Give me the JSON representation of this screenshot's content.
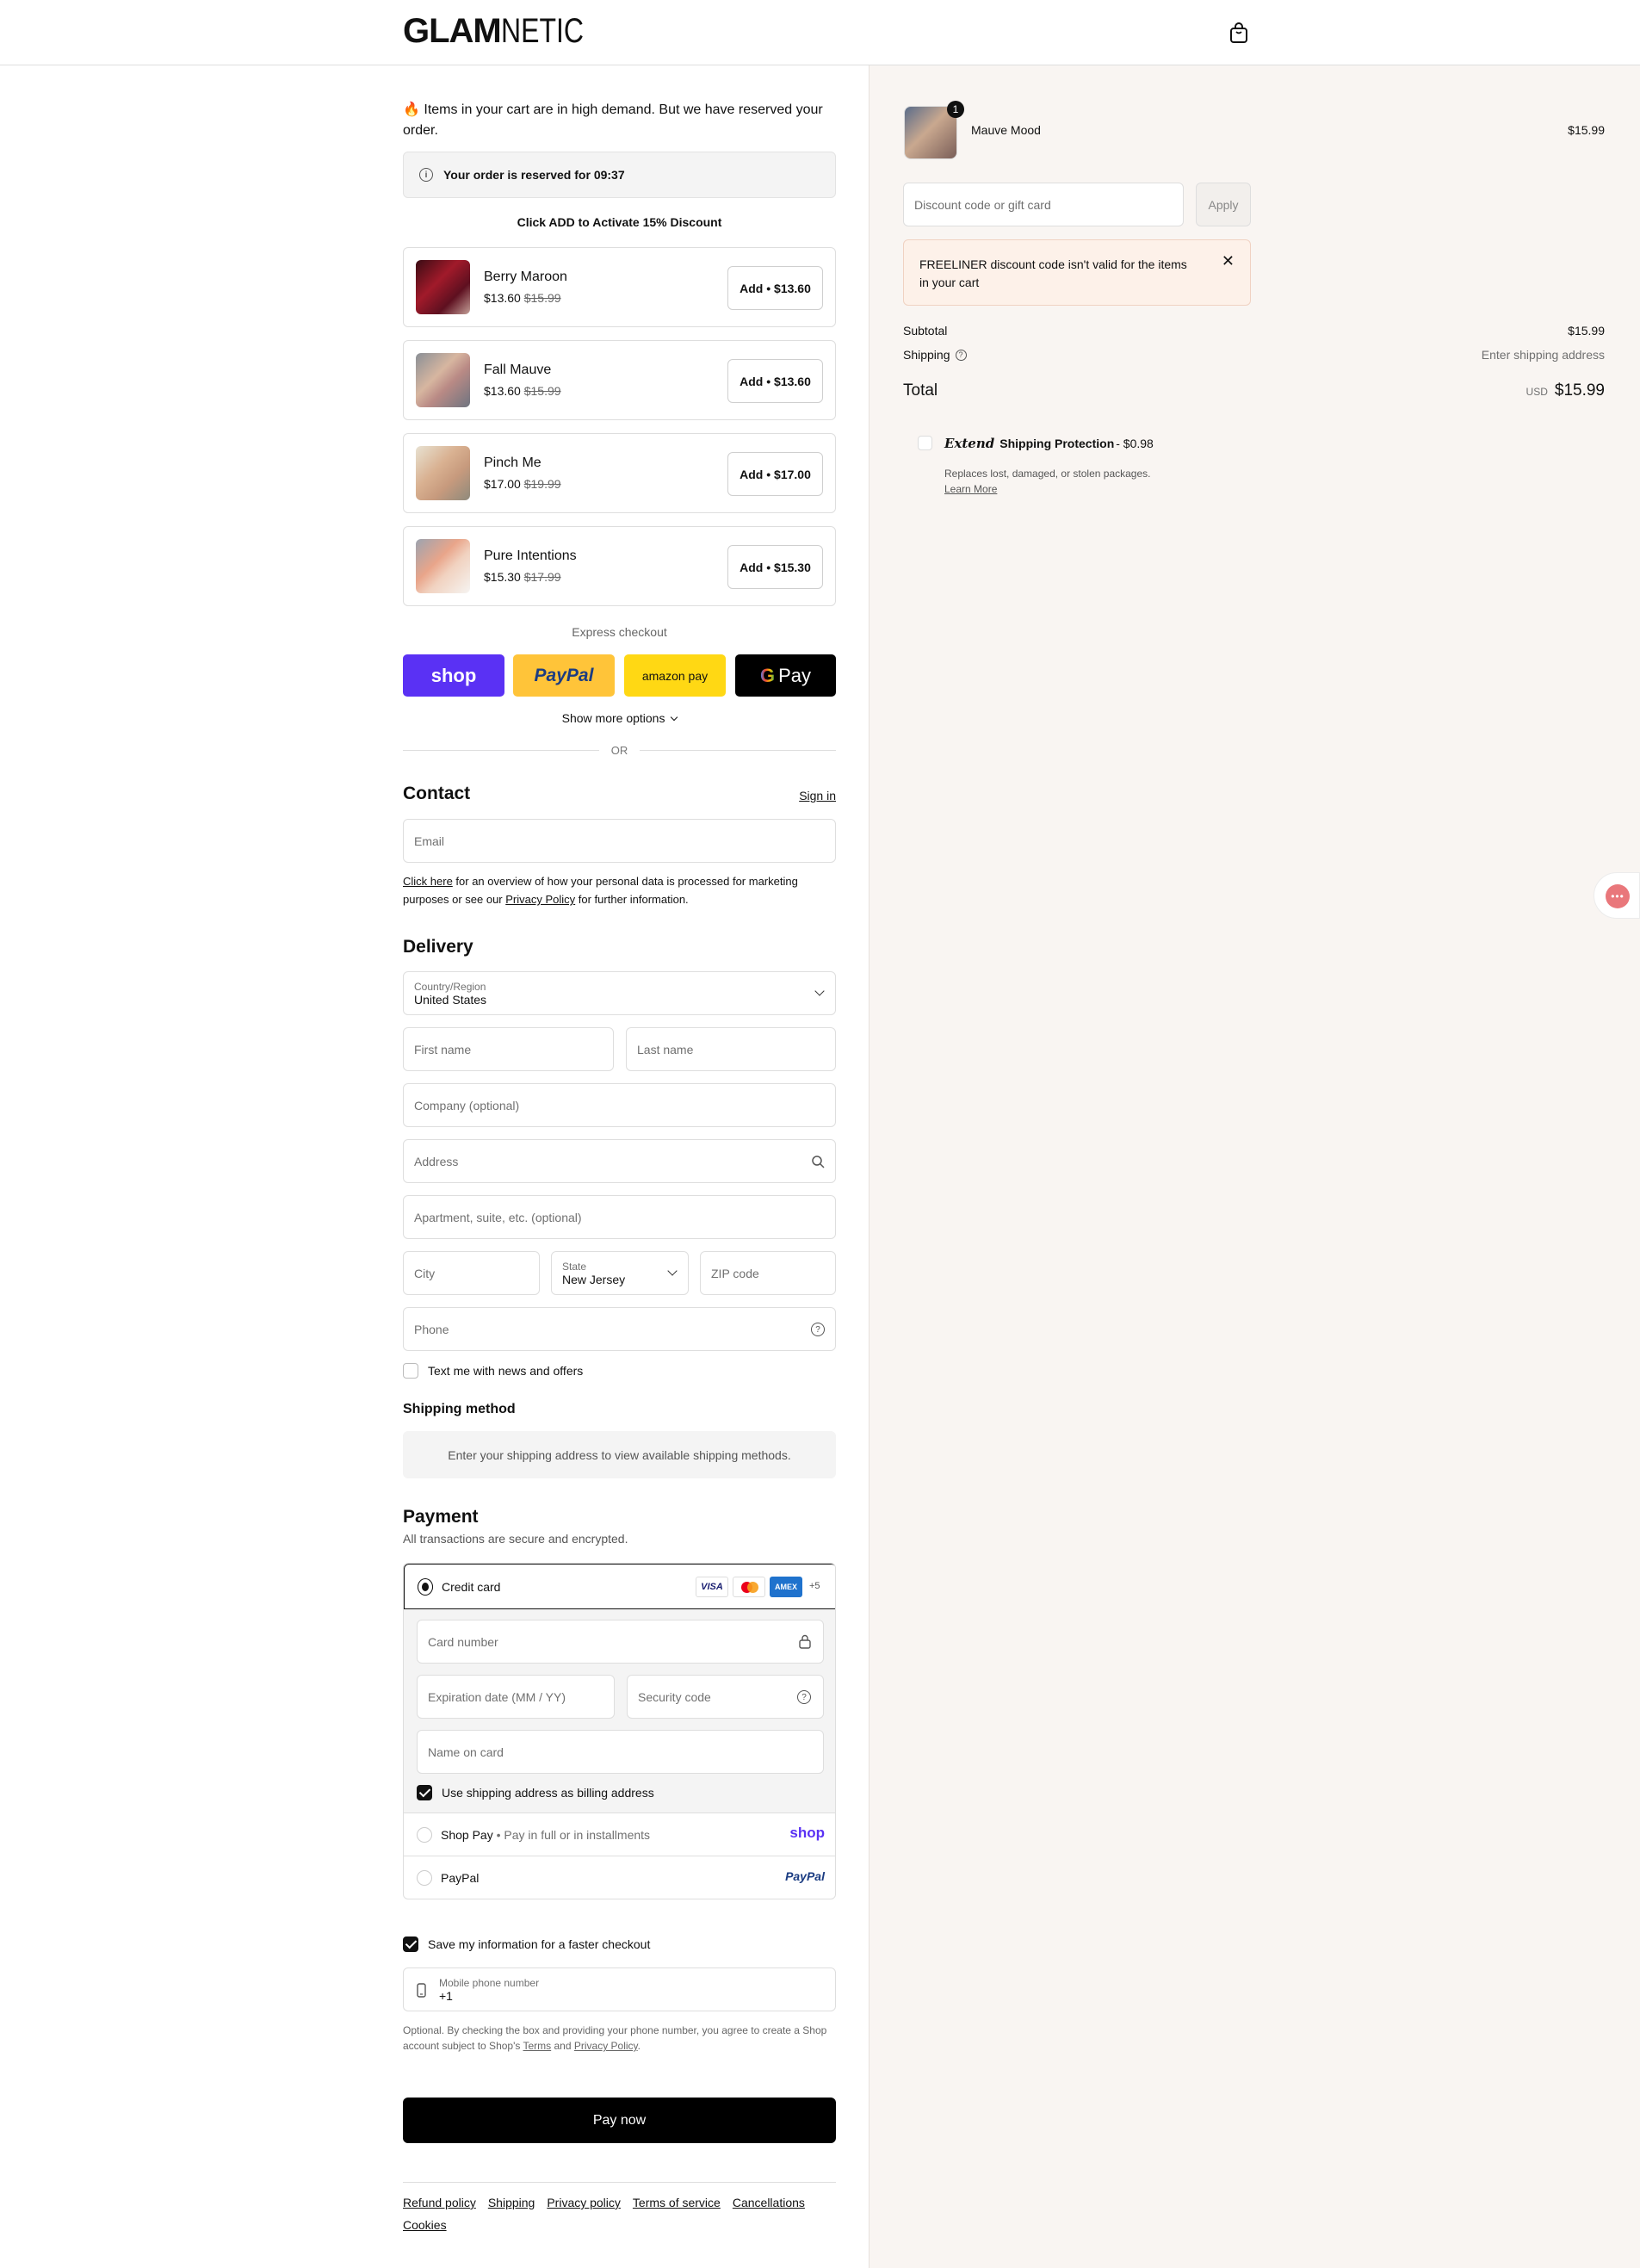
{
  "header": {
    "logo_bold": "GLAM",
    "logo_light": "NETIC"
  },
  "banner": {
    "demand": "🔥 Items in your cart are in high demand. But we have reserved your order.",
    "reserve_prefix": "Your order is reserved for ",
    "reserve_time": "09:37"
  },
  "upsell": {
    "title": "Click ADD to Activate 15% Discount",
    "items": [
      {
        "name": "Berry Maroon",
        "price": "$13.60",
        "compare": "$15.99",
        "button": "Add • $13.60"
      },
      {
        "name": "Fall Mauve",
        "price": "$13.60",
        "compare": "$15.99",
        "button": "Add • $13.60"
      },
      {
        "name": "Pinch Me",
        "price": "$17.00",
        "compare": "$19.99",
        "button": "Add • $17.00"
      },
      {
        "name": "Pure Intentions",
        "price": "$15.30",
        "compare": "$17.99",
        "button": "Add • $15.30"
      }
    ]
  },
  "express": {
    "label": "Express checkout",
    "shop": "shop",
    "paypal": "PayPal",
    "amazon": "amazon pay",
    "gpay": "Pay",
    "more": "Show more options",
    "or": "OR"
  },
  "contact": {
    "title": "Contact",
    "sign_in": "Sign in",
    "email_placeholder": "Email",
    "notice_link": "Click here",
    "notice_mid": " for an overview of how your personal data is processed for marketing purposes or see our ",
    "notice_policy": "Privacy Policy",
    "notice_end": " for further information."
  },
  "delivery": {
    "title": "Delivery",
    "country_label": "Country/Region",
    "country_value": "United States",
    "first_name": "First name",
    "last_name": "Last name",
    "company": "Company (optional)",
    "address": "Address",
    "apartment": "Apartment, suite, etc. (optional)",
    "city": "City",
    "state_label": "State",
    "state_value": "New Jersey",
    "zip": "ZIP code",
    "phone": "Phone",
    "text_offers": "Text me with news and offers"
  },
  "shipping_method": {
    "title": "Shipping method",
    "message": "Enter your shipping address to view available shipping methods."
  },
  "payment": {
    "title": "Payment",
    "subtitle": "All transactions are secure and encrypted.",
    "credit_card": "Credit card",
    "more_cards": "+5",
    "card_number": "Card number",
    "expiry": "Expiration date (MM / YY)",
    "security": "Security code",
    "name_on_card": "Name on card",
    "billing_same": "Use shipping address as billing address",
    "shop_pay": "Shop Pay",
    "shop_pay_sub": "Pay in full or in installments",
    "shop_pay_logo": "shop",
    "paypal": "PayPal",
    "paypal_logo": "PayPal",
    "visa": "VISA",
    "amex": "AMEX"
  },
  "save_info": {
    "label": "Save my information for a faster checkout",
    "mobile_label": "Mobile phone number",
    "mobile_value": "+1",
    "legal_prefix": "Optional. By checking the box and providing your phone number, you agree to create a Shop account subject to Shop's ",
    "terms": "Terms",
    "and": " and ",
    "privacy": "Privacy Policy",
    "end": "."
  },
  "pay_now": "Pay now",
  "footer": {
    "links": [
      "Refund policy",
      "Shipping",
      "Privacy policy",
      "Terms of service",
      "Cancellations"
    ],
    "cookies": "Cookies"
  },
  "summary": {
    "item_name": "Mauve Mood",
    "item_qty": "1",
    "item_price": "$15.99",
    "discount_placeholder": "Discount code or gift card",
    "apply": "Apply",
    "error": "FREELINER discount code isn't valid for the items in your cart",
    "subtotal_label": "Subtotal",
    "subtotal": "$15.99",
    "shipping_label": "Shipping",
    "shipping_value": "Enter shipping address",
    "total_label": "Total",
    "currency": "USD",
    "total": "$15.99",
    "extend_logo": "Extend",
    "extend_title": "Shipping Protection",
    "extend_price": " - $0.98",
    "extend_desc": "Replaces lost, damaged, or stolen packages.",
    "extend_learn": "Learn More"
  }
}
